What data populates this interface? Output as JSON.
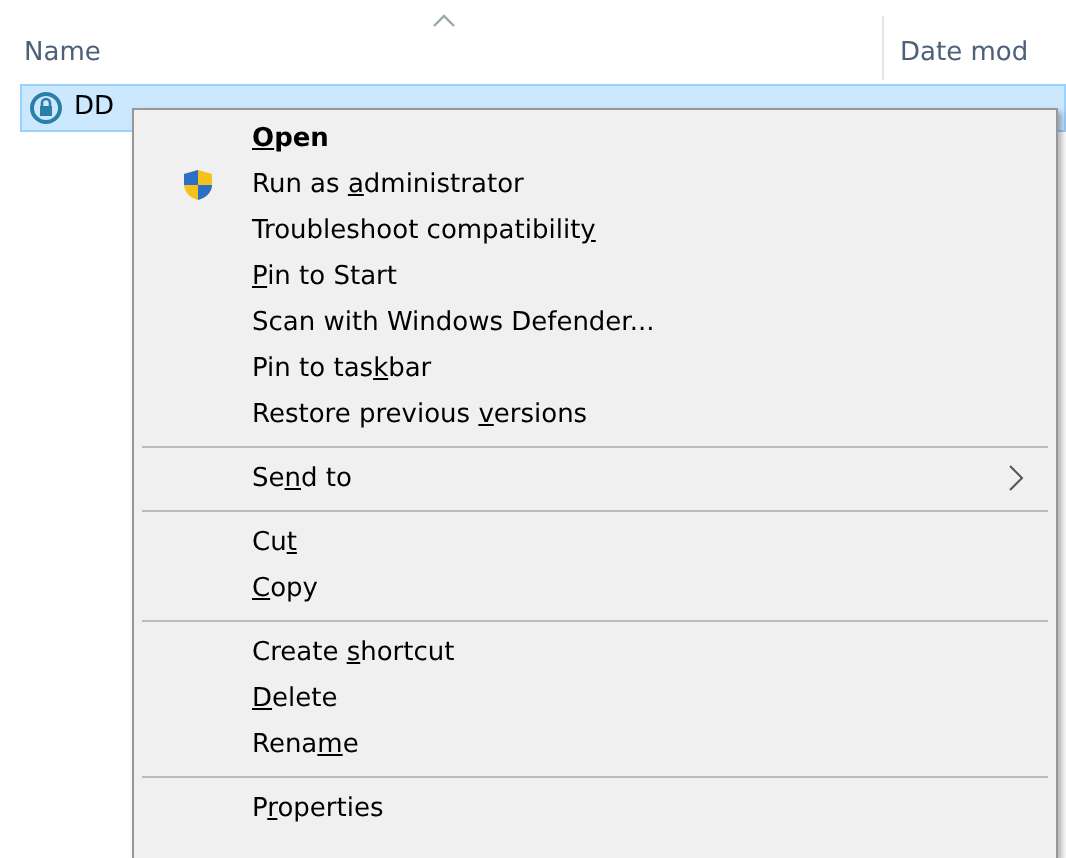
{
  "columns": [
    {
      "label": "Name",
      "sorted": true
    },
    {
      "label": "Date mod",
      "sorted": false
    }
  ],
  "file": {
    "name": "DD",
    "selected": true
  },
  "menu": [
    {
      "kind": "item",
      "segments": [
        {
          "text": "O",
          "underlined": true
        },
        {
          "text": "pen",
          "underlined": false
        }
      ],
      "default": true,
      "shield": false,
      "submenu": false
    },
    {
      "kind": "item",
      "segments": [
        {
          "text": "Run as ",
          "underlined": false
        },
        {
          "text": "a",
          "underlined": true
        },
        {
          "text": "dministrator",
          "underlined": false
        }
      ],
      "default": false,
      "shield": true,
      "submenu": false
    },
    {
      "kind": "item",
      "segments": [
        {
          "text": "Troubleshoot compatibilit",
          "underlined": false
        },
        {
          "text": "y",
          "underlined": true
        }
      ],
      "default": false,
      "shield": false,
      "submenu": false
    },
    {
      "kind": "item",
      "segments": [
        {
          "text": "P",
          "underlined": true
        },
        {
          "text": "in to Start",
          "underlined": false
        }
      ],
      "default": false,
      "shield": false,
      "submenu": false
    },
    {
      "kind": "item",
      "segments": [
        {
          "text": "Scan with Windows Defender...",
          "underlined": false
        }
      ],
      "default": false,
      "shield": false,
      "submenu": false
    },
    {
      "kind": "item",
      "segments": [
        {
          "text": "Pin to tas",
          "underlined": false
        },
        {
          "text": "k",
          "underlined": true
        },
        {
          "text": "bar",
          "underlined": false
        }
      ],
      "default": false,
      "shield": false,
      "submenu": false
    },
    {
      "kind": "item",
      "segments": [
        {
          "text": "Restore previous ",
          "underlined": false
        },
        {
          "text": "v",
          "underlined": true
        },
        {
          "text": "ersions",
          "underlined": false
        }
      ],
      "default": false,
      "shield": false,
      "submenu": false
    },
    {
      "kind": "separator"
    },
    {
      "kind": "item",
      "segments": [
        {
          "text": "Se",
          "underlined": false
        },
        {
          "text": "n",
          "underlined": true
        },
        {
          "text": "d to",
          "underlined": false
        }
      ],
      "default": false,
      "shield": false,
      "submenu": true
    },
    {
      "kind": "separator"
    },
    {
      "kind": "item",
      "segments": [
        {
          "text": "Cu",
          "underlined": false
        },
        {
          "text": "t",
          "underlined": true
        }
      ],
      "default": false,
      "shield": false,
      "submenu": false
    },
    {
      "kind": "item",
      "segments": [
        {
          "text": "C",
          "underlined": true
        },
        {
          "text": "opy",
          "underlined": false
        }
      ],
      "default": false,
      "shield": false,
      "submenu": false
    },
    {
      "kind": "separator"
    },
    {
      "kind": "item",
      "segments": [
        {
          "text": "Create ",
          "underlined": false
        },
        {
          "text": "s",
          "underlined": true
        },
        {
          "text": "hortcut",
          "underlined": false
        }
      ],
      "default": false,
      "shield": false,
      "submenu": false
    },
    {
      "kind": "item",
      "segments": [
        {
          "text": "D",
          "underlined": true
        },
        {
          "text": "elete",
          "underlined": false
        }
      ],
      "default": false,
      "shield": false,
      "submenu": false
    },
    {
      "kind": "item",
      "segments": [
        {
          "text": "Rena",
          "underlined": false
        },
        {
          "text": "m",
          "underlined": true
        },
        {
          "text": "e",
          "underlined": false
        }
      ],
      "default": false,
      "shield": false,
      "submenu": false
    },
    {
      "kind": "separator"
    },
    {
      "kind": "item",
      "segments": [
        {
          "text": "P",
          "underlined": false
        },
        {
          "text": "r",
          "underlined": true
        },
        {
          "text": "operties",
          "underlined": false
        }
      ],
      "default": false,
      "shield": false,
      "submenu": false
    }
  ]
}
